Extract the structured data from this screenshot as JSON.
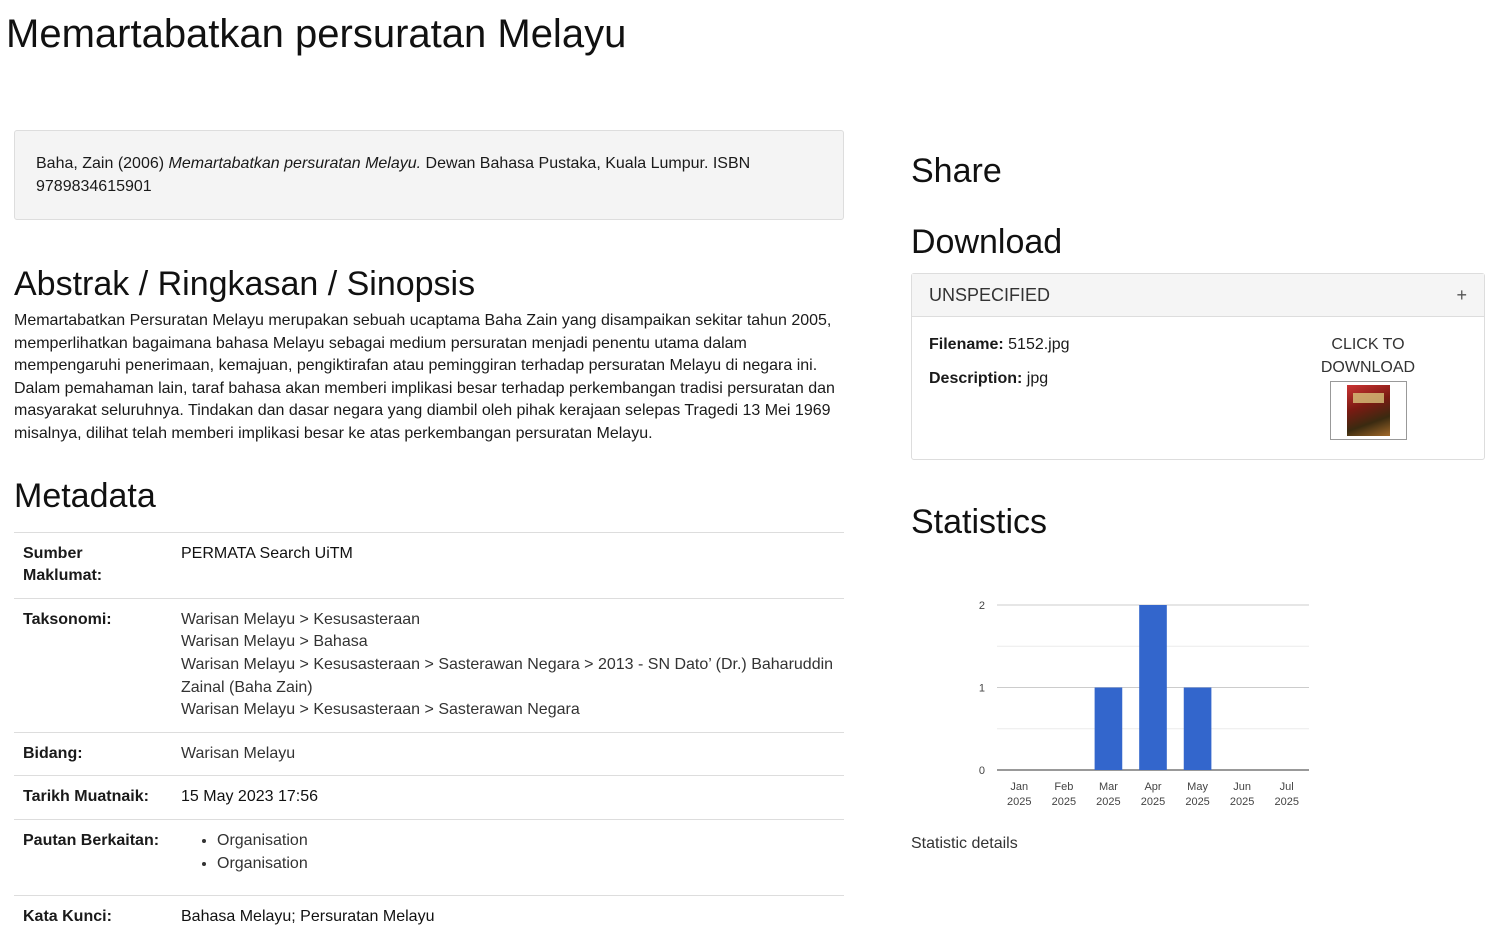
{
  "page": {
    "title": "Memartabatkan persuratan Melayu"
  },
  "citation": {
    "prefix": "Baha, Zain (2006) ",
    "title_italic": "Memartabatkan persuratan Melayu.",
    "suffix": " Dewan Bahasa Pustaka, Kuala Lumpur. ISBN 9789834615901"
  },
  "abstract": {
    "heading": "Abstrak / Ringkasan / Sinopsis",
    "text": "Memartabatkan Persuratan Melayu merupakan sebuah ucaptama Baha Zain yang disampaikan sekitar tahun 2005, memperlihatkan bagaimana bahasa Melayu sebagai medium persuratan menjadi penentu utama dalam mempengaruhi penerimaan, kemajuan, pengiktirafan atau peminggiran terhadap persuratan Melayu di negara ini. Dalam pemahaman lain, taraf bahasa akan memberi implikasi besar terhadap perkembangan tradisi persuratan dan masyarakat seluruhnya. Tindakan dan dasar negara yang diambil oleh pihak kerajaan selepas Tragedi 13 Mei 1969 misalnya, dilihat telah memberi implikasi besar ke atas perkembangan persuratan Melayu."
  },
  "metadata": {
    "heading": "Metadata",
    "rows": {
      "sumber": {
        "key": "Sumber Maklumat:",
        "value": "PERMATA Search UiTM"
      },
      "taksonomi": {
        "key": "Taksonomi:",
        "items": [
          "Warisan Melayu > Kesusasteraan",
          "Warisan Melayu > Bahasa",
          "Warisan Melayu > Kesusasteraan > Sasterawan Negara > 2013 - SN Dato’ (Dr.) Baharuddin Zainal (Baha Zain)",
          "Warisan Melayu > Kesusasteraan > Sasterawan Negara"
        ]
      },
      "bidang": {
        "key": "Bidang:",
        "value": "Warisan Melayu"
      },
      "tarikh": {
        "key": "Tarikh Muatnaik:",
        "value": "15 May 2023 17:56"
      },
      "pautan": {
        "key": "Pautan Berkaitan:",
        "items": [
          "Organisation",
          "Organisation"
        ]
      },
      "kata": {
        "key": "Kata Kunci:",
        "value": "Bahasa Melayu; Persuratan Melayu"
      }
    }
  },
  "share": {
    "heading": "Share"
  },
  "download": {
    "heading": "Download",
    "panel_title": "UNSPECIFIED",
    "toggle_glyph": "+",
    "filename_label": "Filename:",
    "filename": "5152.jpg",
    "description_label": "Description:",
    "description": "jpg",
    "link_text": "CLICK TO DOWNLOAD"
  },
  "statistics": {
    "heading": "Statistics",
    "details_link": "Statistic details"
  },
  "chart_data": {
    "type": "bar",
    "categories": [
      "Jan 2025",
      "Feb 2025",
      "Mar 2025",
      "Apr 2025",
      "May 2025",
      "Jun 2025",
      "Jul 2025"
    ],
    "values": [
      0,
      0,
      1,
      2,
      1,
      0,
      0
    ],
    "ylim": [
      0,
      2
    ],
    "yticks": [
      "0",
      "1",
      "2"
    ],
    "grid": true,
    "bar_color": "#3366cc"
  }
}
